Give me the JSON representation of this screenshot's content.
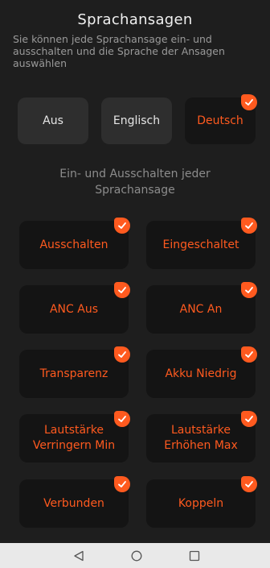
{
  "header": {
    "title": "Sprachansagen",
    "subtitle": "Sie können jede Sprachansage ein- und ausschalten und die Sprache der Ansagen auswählen"
  },
  "language": {
    "options": [
      {
        "label": "Aus"
      },
      {
        "label": "Englisch"
      },
      {
        "label": "Deutsch"
      }
    ],
    "selected": "Deutsch"
  },
  "section": {
    "label_line1": "Ein- und Ausschalten jeder",
    "label_line2": "Sprachansage"
  },
  "prompts": [
    {
      "label": "Ausschalten",
      "enabled": true
    },
    {
      "label": "Eingeschaltet",
      "enabled": true
    },
    {
      "label": "ANC Aus",
      "enabled": true
    },
    {
      "label": "ANC An",
      "enabled": true
    },
    {
      "label": "Transparenz",
      "enabled": true
    },
    {
      "label": "Akku Niedrig",
      "enabled": true
    },
    {
      "label_line1": "Lautstärke",
      "label_line2": "Verringern Min",
      "enabled": true
    },
    {
      "label_line1": "Lautstärke",
      "label_line2": "Erhöhen Max",
      "enabled": true
    },
    {
      "label": "Verbunden",
      "enabled": true
    },
    {
      "label": "Koppeln",
      "enabled": true
    }
  ],
  "colors": {
    "accent": "#ff5a1f",
    "background": "#1e1e1e",
    "tile": "#141414",
    "navbar": "#e9e9e9"
  },
  "navbar": {
    "icons": [
      "back-triangle-icon",
      "home-circle-icon",
      "recents-square-icon"
    ]
  }
}
